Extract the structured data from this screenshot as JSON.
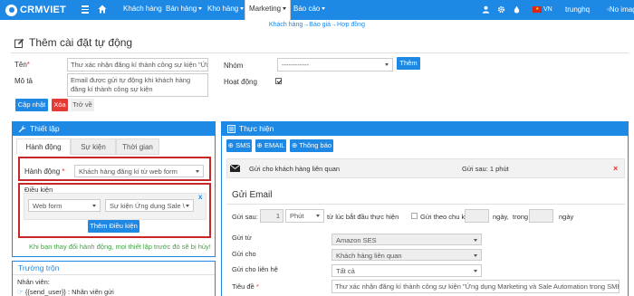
{
  "topbar": {
    "logo_text": "CRMVIET",
    "nav": [
      "Khách hàng",
      "Bán hàng",
      "Kho hàng",
      "Marketing",
      "Báo cáo"
    ],
    "active_nav": "Marketing",
    "language": "VN",
    "username": "trunghq",
    "avatar_alt": "No image",
    "colors": {
      "bar": "#1e88e5"
    }
  },
  "breadcrumb": "Khách hàng→Báo giá→Hợp đồng",
  "page": {
    "title": "Thêm cài đặt tự động"
  },
  "form": {
    "ten_label": "Tên",
    "ten_value": "Thư xác nhận đăng kí thành công sự kiện \"Ứng",
    "mota_label": "Mô tả",
    "mota_value": "Email được gửi tự động khi khách hàng đăng kí thành công sự kiện",
    "nhom_label": "Nhóm",
    "nhom_value": "------------",
    "them_button": "Thêm",
    "hoatdong_label": "Hoạt động",
    "hoatdong_checked": true,
    "capnhat_button": "Cập nhật",
    "xoa_button": "Xóa",
    "trove_button": "Trở về"
  },
  "thietlap": {
    "title": "Thiết lập",
    "tabs": [
      "Hành động",
      "Sự kiện",
      "Thời gian"
    ],
    "hanhdong_label": "Hành động",
    "hanhdong_value": "Khách hàng đăng kí từ web form",
    "dieukien_label": "Điều kiện",
    "condition_field": "Web form",
    "condition_value": "Sự kiện Ứng dụng Sale \\",
    "them_dieukien_button": "Thêm Điều kiện",
    "remove_icon": "x",
    "warning": "Khi bạn thay đổi hành động, mọi thiết lập trước đó sẽ bị hủy!"
  },
  "truongtron": {
    "title": "Trường trộn",
    "nhanvien_label": "Nhân viên:",
    "send_user_token": "{{send_user}}",
    "send_user_desc": ": Nhân viên gửi"
  },
  "thuchien": {
    "title": "Thực hiện",
    "buttons": [
      "SMS",
      "EMAIL",
      "Thông báo"
    ],
    "action_row": {
      "label": "Gửi cho khách hàng liên quan",
      "timing": "Gửi sau: 1 phút"
    },
    "email": {
      "heading": "Gửi Email",
      "guisau_label": "Gửi sau:",
      "delay_value": "1",
      "delay_unit": "Phút",
      "delay_suffix": "từ lúc bắt đầu thực hiện",
      "guitheochuky_label": "Gửi theo chu kì",
      "ngay_label": "ngày,",
      "trong_label": "trong",
      "ngay2_label": "ngày",
      "guitu_label": "Gửi từ",
      "guitu_value": "Amazon SES",
      "guicho_label": "Gửi cho",
      "guicho_value": "Khách hàng liên quan",
      "guicholienhe_label": "Gửi cho liên hệ",
      "guicholienhe_value": "Tất cả",
      "tieude_label": "Tiêu đề",
      "tieude_value": "Thư xác nhận đăng kí thành công sự kiện \"Ứng dụng Marketing và Sale Automation trong SME\""
    }
  }
}
